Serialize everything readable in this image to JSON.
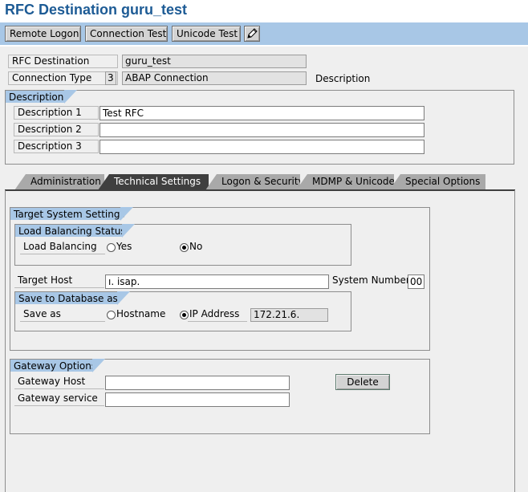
{
  "title": "RFC Destination guru_test",
  "toolbar": {
    "remote_logon": "Remote Logon",
    "connection_test": "Connection Test",
    "unicode_test": "Unicode Test",
    "edit_icon": "pencil-icon"
  },
  "header": {
    "rfc_destination_label": "RFC Destination",
    "rfc_destination_value": "guru_test",
    "connection_type_label": "Connection Type",
    "connection_type_code": "3",
    "connection_type_value": "ABAP Connection",
    "description_link": "Description"
  },
  "description_group": {
    "title": "Description",
    "rows": [
      {
        "label": "Description 1",
        "value": "Test RFC"
      },
      {
        "label": "Description 2",
        "value": ""
      },
      {
        "label": "Description 3",
        "value": ""
      }
    ]
  },
  "tabs": [
    {
      "label": "Administration",
      "active": false
    },
    {
      "label": "Technical Settings",
      "active": true
    },
    {
      "label": "Logon & Security",
      "active": false
    },
    {
      "label": "MDMP & Unicode",
      "active": false
    },
    {
      "label": "Special Options",
      "active": false
    }
  ],
  "target_system": {
    "title": "Target System Settings",
    "load_balancing_status": {
      "title": "Load Balancing Status",
      "label": "Load Balancing",
      "yes_label": "Yes",
      "no_label": "No",
      "selected": "No"
    },
    "target_host_label": "Target Host",
    "target_host_value": "ı. isap.",
    "system_number_label": "System Number",
    "system_number_value": "00",
    "save_to_db": {
      "title": "Save to Database as",
      "label": "Save as",
      "hostname_label": "Hostname",
      "ip_label": "IP Address",
      "selected": "IP Address",
      "ip_value": "172.21.6."
    }
  },
  "gateway": {
    "title": "Gateway Options",
    "host_label": "Gateway Host",
    "host_value": "",
    "service_label": "Gateway service",
    "service_value": "",
    "delete_label": "Delete"
  },
  "colors": {
    "title_blue": "#1d5b95",
    "toolbar_blue": "#a8c7e6",
    "panel_gray": "#efefef",
    "active_tab": "#3f3f3f"
  }
}
